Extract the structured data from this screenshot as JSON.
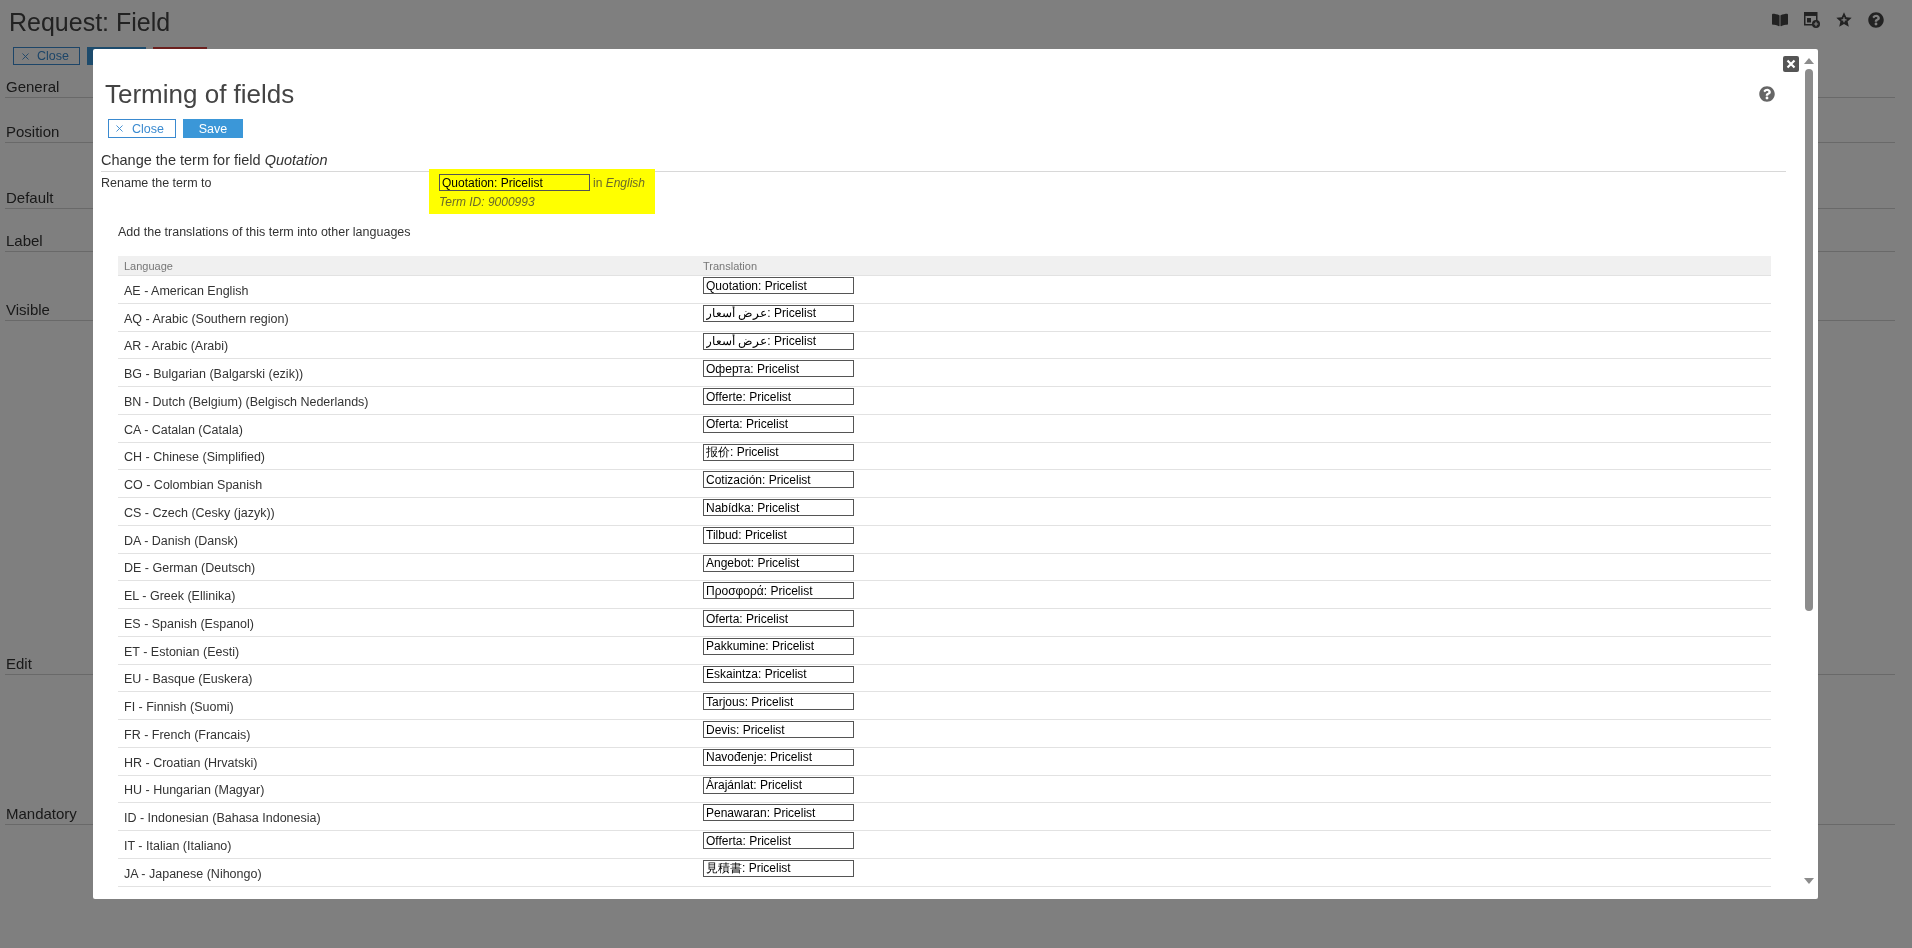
{
  "page": {
    "title": "Request: Field",
    "toolbar": [
      {
        "kind": "close",
        "label": "Close"
      },
      {
        "kind": "primary"
      },
      {
        "kind": "danger"
      }
    ],
    "sections": [
      "General",
      "Position",
      "Default",
      "Label",
      "Visible",
      "Edit",
      "Mandatory"
    ]
  },
  "dialog": {
    "title": "Terming of fields",
    "buttons": [
      {
        "kind": "close",
        "label": "Close"
      },
      {
        "kind": "save",
        "label": "Save"
      }
    ],
    "heading": "Change the term for field *Quotation*",
    "rename": {
      "label": "Rename the term to",
      "value": "Quotation: Pricelist",
      "language_note": "in *English*",
      "term_id": "Term ID: 9000993"
    },
    "translations_intro": "Add the translations of this term into other languages",
    "table": {
      "columns": [
        "Language",
        "Translation"
      ],
      "rows": [
        {
          "language": "AE - American English",
          "translation": "Quotation: Pricelist"
        },
        {
          "language": "AQ - Arabic (Southern region)",
          "translation": "عرض أسعار: Pricelist"
        },
        {
          "language": "AR - Arabic (Arabi)",
          "translation": "عرض أسعار: Pricelist"
        },
        {
          "language": "BG - Bulgarian (Balgarski (ezik))",
          "translation": "Оферта: Pricelist"
        },
        {
          "language": "BN - Dutch (Belgium) (Belgisch Nederlands)",
          "translation": "Offerte: Pricelist"
        },
        {
          "language": "CA - Catalan (Catala)",
          "translation": "Oferta: Pricelist"
        },
        {
          "language": "CH - Chinese (Simplified)",
          "translation": "报价: Pricelist"
        },
        {
          "language": "CO - Colombian Spanish",
          "translation": "Cotización: Pricelist"
        },
        {
          "language": "CS - Czech (Cesky (jazyk))",
          "translation": "Nabídka: Pricelist"
        },
        {
          "language": "DA - Danish (Dansk)",
          "translation": "Tilbud: Pricelist"
        },
        {
          "language": "DE - German (Deutsch)",
          "translation": "Angebot: Pricelist"
        },
        {
          "language": "EL - Greek (Ellinika)",
          "translation": "Προσφορά: Pricelist"
        },
        {
          "language": "ES - Spanish (Espanol)",
          "translation": "Oferta: Pricelist"
        },
        {
          "language": "ET - Estonian (Eesti)",
          "translation": "Pakkumine: Pricelist"
        },
        {
          "language": "EU - Basque (Euskera)",
          "translation": "Eskaintza: Pricelist"
        },
        {
          "language": "FI - Finnish (Suomi)",
          "translation": "Tarjous: Pricelist"
        },
        {
          "language": "FR - French (Francais)",
          "translation": "Devis: Pricelist"
        },
        {
          "language": "HR - Croatian (Hrvatski)",
          "translation": "Navođenje: Pricelist"
        },
        {
          "language": "HU - Hungarian (Magyar)",
          "translation": "Árajánlat: Pricelist"
        },
        {
          "language": "ID - Indonesian (Bahasa Indonesia)",
          "translation": "Penawaran: Pricelist"
        },
        {
          "language": "IT - Italian (Italiano)",
          "translation": "Offerta: Pricelist"
        },
        {
          "language": "JA - Japanese (Nihongo)",
          "translation": "見積書: Pricelist"
        }
      ]
    }
  }
}
